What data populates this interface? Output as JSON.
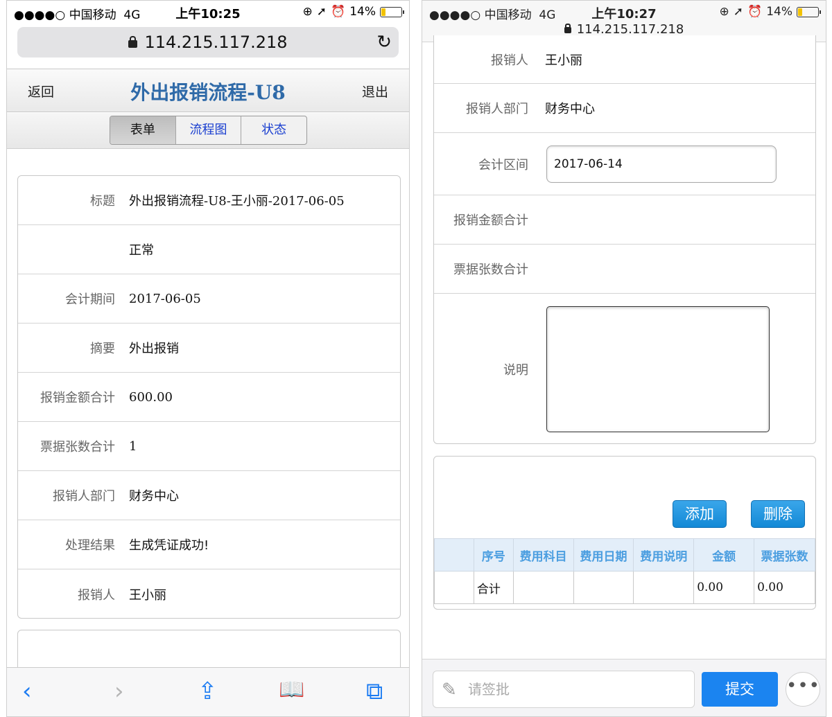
{
  "left": {
    "status": {
      "carrier": "●●●●○ 中国移动",
      "network": "4G",
      "time": "上午10:25",
      "battery": "14%"
    },
    "url": "114.215.117.218",
    "nav": {
      "back": "返回",
      "title": "外出报销流程-U8",
      "exit": "退出"
    },
    "tabs": [
      "表单",
      "流程图",
      "状态"
    ],
    "fields": [
      {
        "label": "标题",
        "value": "外出报销流程-U8-王小丽-2017-06-05"
      },
      {
        "label": "",
        "value": "正常"
      },
      {
        "label": "会计期间",
        "value": "2017-06-05"
      },
      {
        "label": "摘要",
        "value": "外出报销"
      },
      {
        "label": "报销金额合计",
        "value": "600.00"
      },
      {
        "label": "票据张数合计",
        "value": "1"
      },
      {
        "label": "报销人部门",
        "value": "财务中心"
      },
      {
        "label": "处理结果",
        "value": "生成凭证成功!"
      },
      {
        "label": "报销人",
        "value": "王小丽"
      }
    ],
    "toolbar": {
      "back_icon": "‹",
      "forward_icon": "›",
      "share_icon": "⇪",
      "bookmarks_icon": "📖",
      "tabs_icon": "⧉"
    }
  },
  "right": {
    "status": {
      "carrier": "●●●●○ 中国移动",
      "network": "4G",
      "time": "上午10:27",
      "battery": "14%"
    },
    "url": "114.215.117.218",
    "fields": [
      {
        "label": "报销人",
        "value": "王小丽"
      },
      {
        "label": "报销人部门",
        "value": "财务中心"
      },
      {
        "label": "会计区间",
        "value": "2017-06-14"
      },
      {
        "label": "报销金额合计",
        "value": ""
      },
      {
        "label": "票据张数合计",
        "value": ""
      },
      {
        "label": "说明",
        "value": ""
      }
    ],
    "buttons": {
      "add": "添加",
      "delete": "删除"
    },
    "table": {
      "headers": [
        "",
        "序号",
        "费用科目",
        "费用日期",
        "费用说明",
        "金额",
        "票据张数"
      ],
      "total_row": [
        "",
        "合计",
        "",
        "",
        "",
        "0.00",
        "0.00"
      ]
    },
    "bottom": {
      "placeholder": "请签批",
      "submit": "提交",
      "more": "•••"
    }
  }
}
